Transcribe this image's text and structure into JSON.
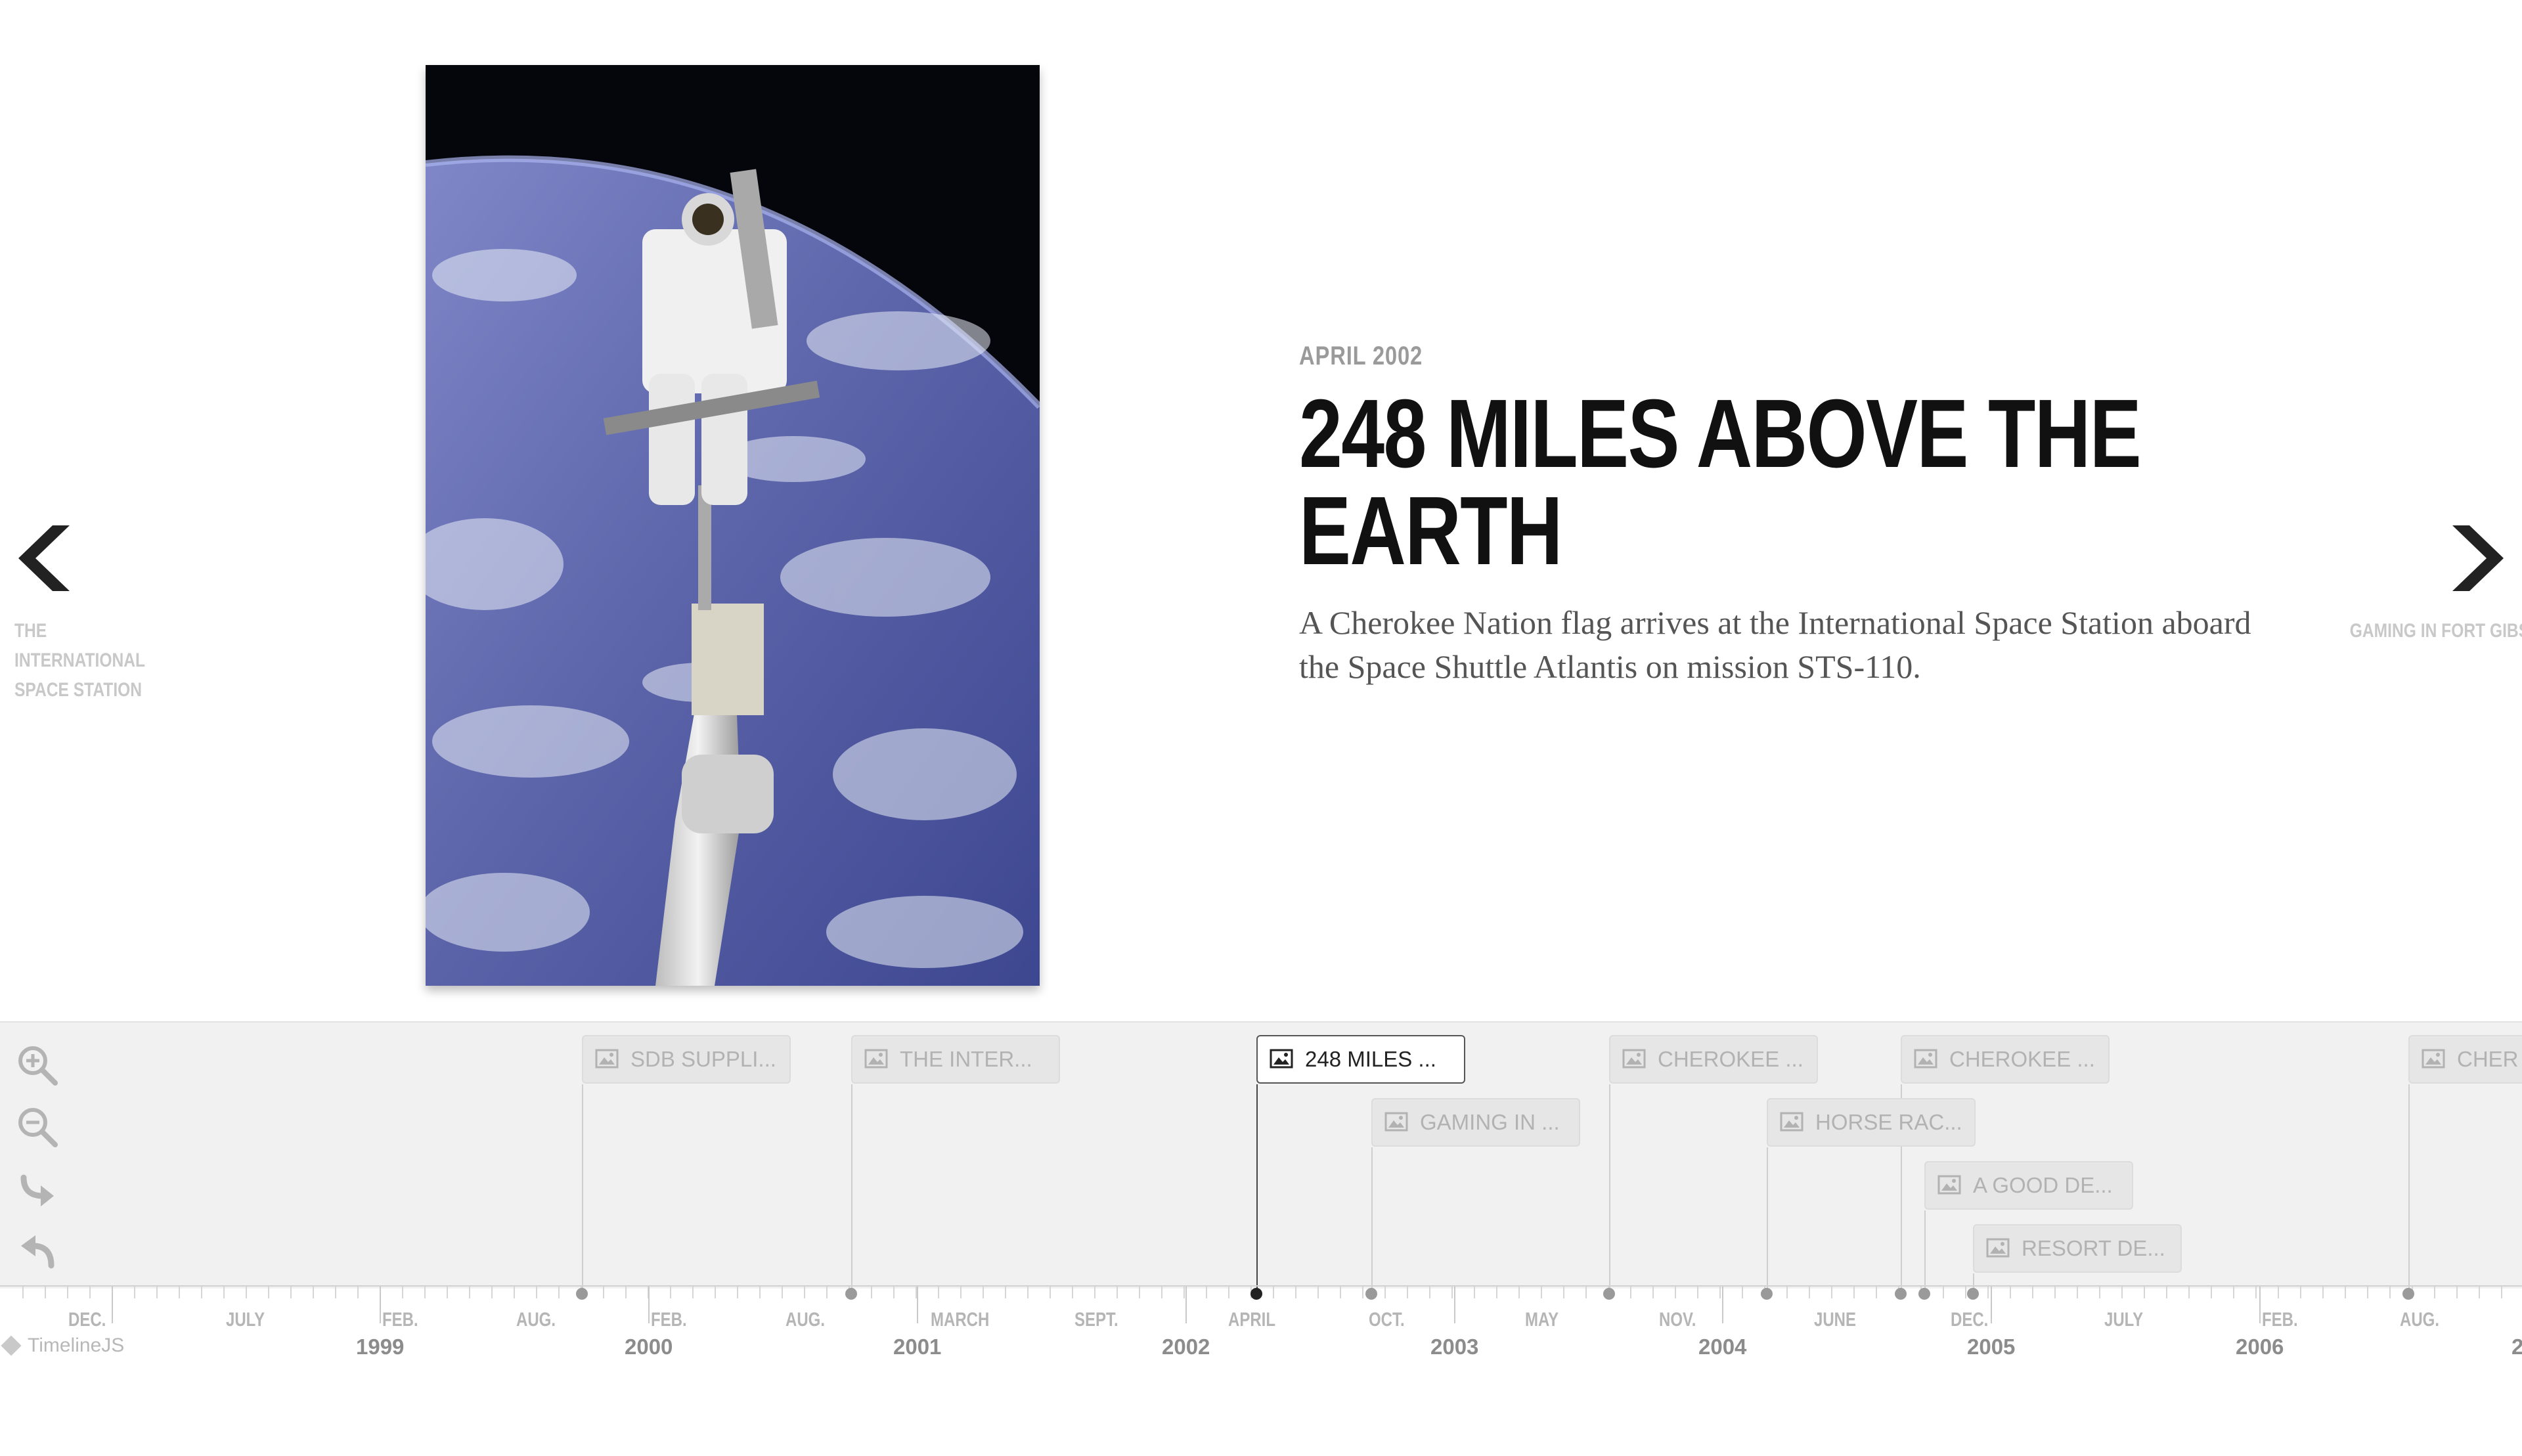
{
  "slide": {
    "date": "APRIL 2002",
    "headline": "248 MILES ABOVE THE EARTH",
    "text": "A Cherokee Nation flag arrives at the International Space Station aboard the Space Shuttle Atlantis on mission STS-110."
  },
  "nav": {
    "prev_label": "THE INTERNATIONAL SPACE STATION",
    "next_label": "GAMING IN FORT GIBSON"
  },
  "tools": {
    "zoom_in": "zoom-in-icon",
    "zoom_out": "zoom-out-icon",
    "redo": "redo-icon",
    "undo": "undo-icon"
  },
  "flags": [
    {
      "label": "SDB SUPPLI..."
    },
    {
      "label": "THE INTER..."
    },
    {
      "label": "248 MILES ..."
    },
    {
      "label": "GAMING IN ..."
    },
    {
      "label": "CHEROKEE ..."
    },
    {
      "label": "HORSE RAC..."
    },
    {
      "label": "CHEROKEE ..."
    },
    {
      "label": "A GOOD DE..."
    },
    {
      "label": "RESORT DE..."
    },
    {
      "label": "CHER"
    }
  ],
  "axis": {
    "months": [
      "DEC.",
      "JULY",
      "FEB.",
      "AUG.",
      "FEB.",
      "AUG.",
      "MARCH",
      "SEPT.",
      "APRIL",
      "OCT.",
      "MAY",
      "NOV.",
      "JUNE",
      "DEC.",
      "JULY",
      "FEB.",
      "AUG."
    ],
    "years": [
      "1999",
      "2000",
      "2001",
      "2002",
      "2003",
      "2004",
      "2005",
      "2006",
      "2"
    ]
  },
  "brand": "TimelineJS",
  "colors": {
    "active": "#222222",
    "inactive_flag": "#e6e6e6",
    "timeline_bg": "#f1f1f1"
  }
}
